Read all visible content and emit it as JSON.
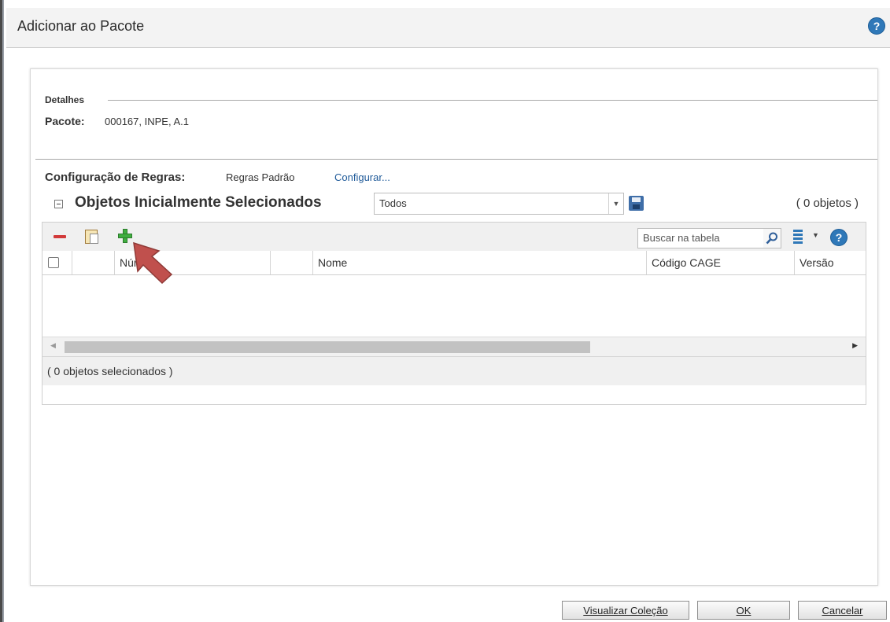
{
  "dialog": {
    "title": "Adicionar ao Pacote"
  },
  "details": {
    "section_label": "Detalhes",
    "package_label": "Pacote:",
    "package_value": "000167, INPE, A.1"
  },
  "rules": {
    "label": "Configuração de Regras:",
    "value": "Regras Padrão",
    "link": "Configurar..."
  },
  "objects": {
    "heading": "Objetos Inicialmente Selecionados",
    "filter_selected": "Todos",
    "count": "( 0 objetos )"
  },
  "table": {
    "search_placeholder": "Buscar na tabela",
    "columns": [
      "Número",
      "Nome",
      "Código CAGE",
      "Versão"
    ],
    "rows": [],
    "selection_status": "( 0 objetos selecionados )"
  },
  "buttons": {
    "view_collection": "Visualizar Coleção",
    "ok": "OK",
    "cancel": "Cancelar"
  },
  "colors": {
    "link": "#1f5a99",
    "help_icon": "#2f78b8",
    "remove_icon": "#d23a3a",
    "add_icon": "#3fae3f",
    "annotation_arrow": "#c0504d"
  }
}
